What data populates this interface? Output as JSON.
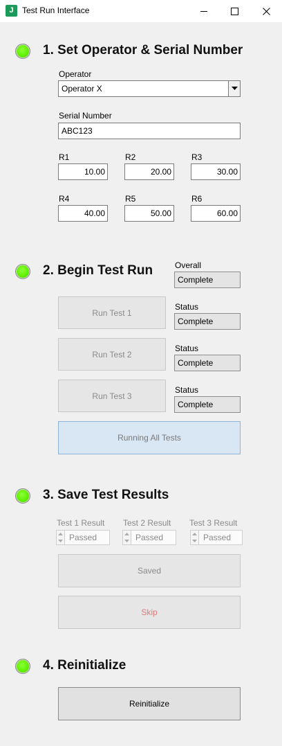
{
  "window": {
    "title": "Test Run Interface",
    "icon_letter": "J",
    "icon_color": "#1b9a5a"
  },
  "section1": {
    "heading": "1. Set Operator & Serial Number",
    "operator_label": "Operator",
    "operator_value": "Operator X",
    "serial_label": "Serial Number",
    "serial_value": "ABC123",
    "r_fields": [
      {
        "label": "R1",
        "value": "10.00"
      },
      {
        "label": "R2",
        "value": "20.00"
      },
      {
        "label": "R3",
        "value": "30.00"
      },
      {
        "label": "R4",
        "value": "40.00"
      },
      {
        "label": "R5",
        "value": "50.00"
      },
      {
        "label": "R6",
        "value": "60.00"
      }
    ]
  },
  "section2": {
    "heading": "2. Begin Test Run",
    "overall_label": "Overall",
    "overall_value": "Complete",
    "tests": [
      {
        "button": "Run Test 1",
        "status_label": "Status",
        "status_value": "Complete"
      },
      {
        "button": "Run Test 2",
        "status_label": "Status",
        "status_value": "Complete"
      },
      {
        "button": "Run Test 3",
        "status_label": "Status",
        "status_value": "Complete"
      }
    ],
    "run_all_label": "Running All Tests"
  },
  "section3": {
    "heading": "3. Save Test Results",
    "results": [
      {
        "label": "Test 1 Result",
        "value": "Passed"
      },
      {
        "label": "Test 2 Result",
        "value": "Passed"
      },
      {
        "label": "Test 3 Result",
        "value": "Passed"
      }
    ],
    "save_label": "Saved",
    "skip_label": "Skip"
  },
  "section4": {
    "heading": "4. Reinitialize",
    "button_label": "Reinitialize"
  },
  "colors": {
    "led_green": "#5ff000",
    "running_button_bg": "#d9e6f3",
    "skip_text": "#e07a7a"
  }
}
